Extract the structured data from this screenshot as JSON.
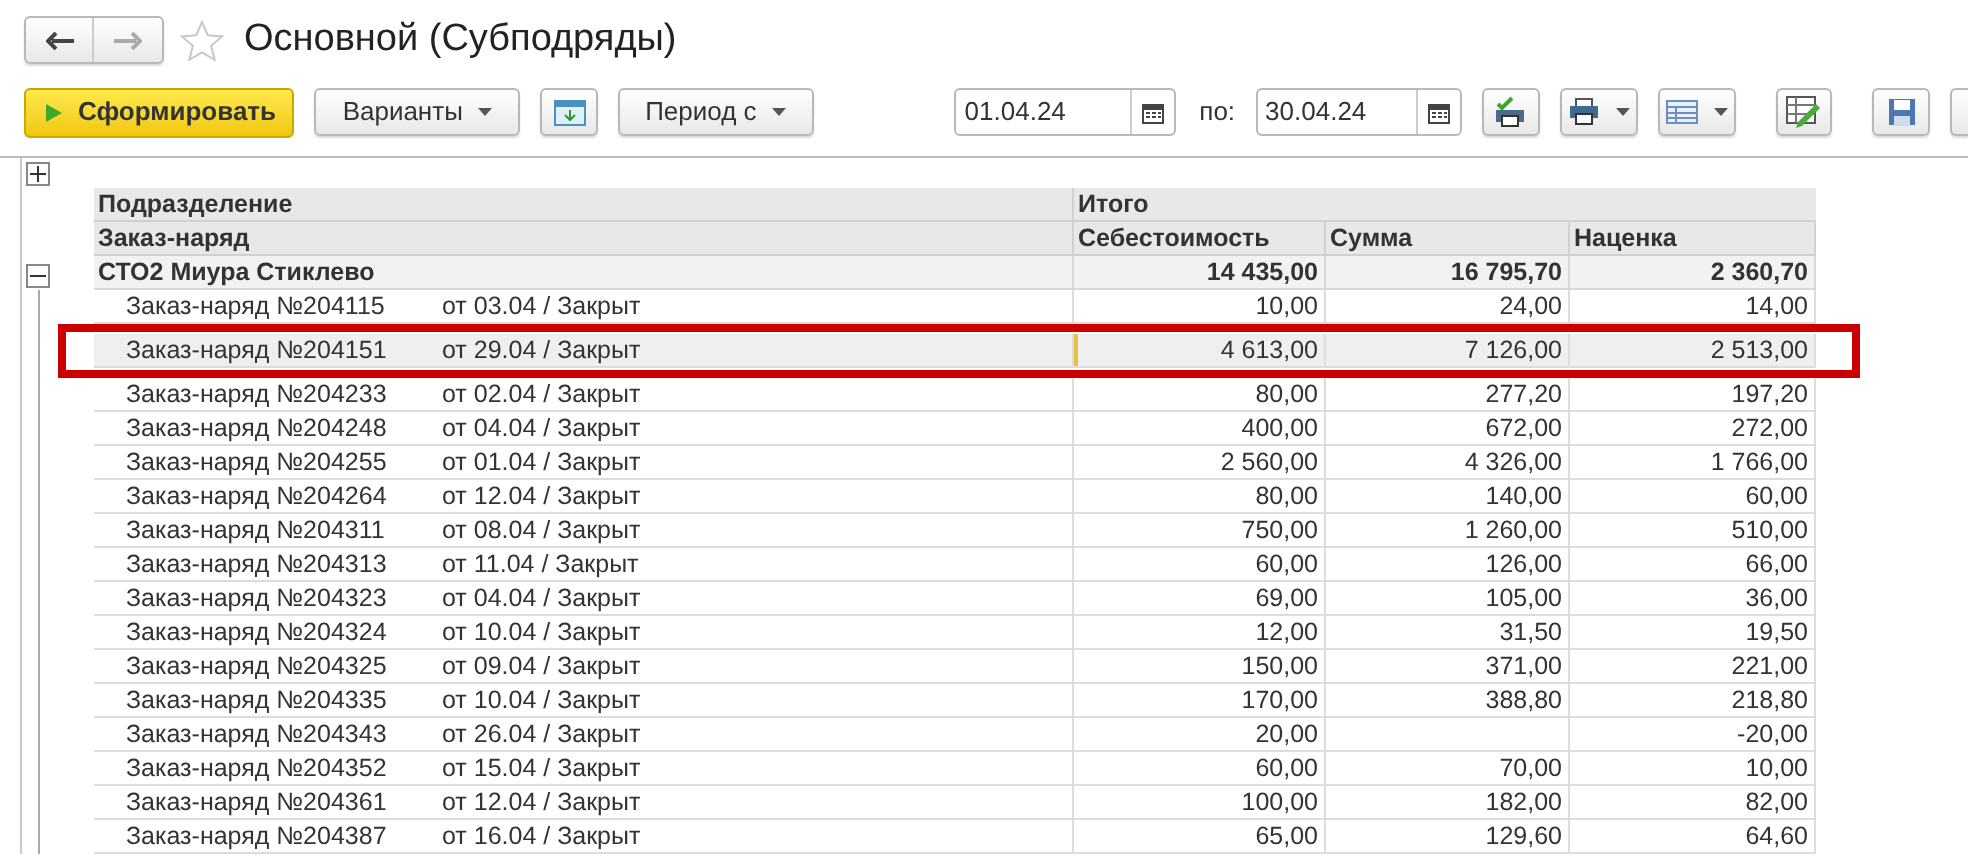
{
  "window": {
    "title": "Основной (Субподряды)",
    "favorite": false
  },
  "toolbar": {
    "generate_button": "Сформировать",
    "variants_button": "Варианты",
    "period_button": "Период с",
    "date_from": "01.04.24",
    "to_label": "по:",
    "date_to": "30.04.24"
  },
  "table": {
    "header_rows": [
      {
        "column_1": "Подразделение",
        "column_2": "Итого"
      },
      {
        "column_1": "Заказ-наряд",
        "columns": [
          "Себестоимость",
          "Сумма",
          "Наценка"
        ]
      }
    ],
    "group": {
      "name": "СТО2 Миура Стиклево",
      "expanded": true,
      "values": [
        "14 435,00",
        "16 795,70",
        "2 360,70"
      ]
    },
    "rows": [
      {
        "order": "Заказ-наряд №204115",
        "date_status": "от 03.04 / Закрыт",
        "cost": "10,00",
        "sum": "24,00",
        "markup": "14,00",
        "selected": false,
        "highlighted": false
      },
      {
        "order": "Заказ-наряд №204151",
        "date_status": "от 29.04 / Закрыт",
        "cost": "4 613,00",
        "sum": "7 126,00",
        "markup": "2 513,00",
        "selected": true,
        "highlighted": true
      },
      {
        "order": "Заказ-наряд №204233",
        "date_status": "от 02.04 / Закрыт",
        "cost": "80,00",
        "sum": "277,20",
        "markup": "197,20",
        "selected": false,
        "highlighted": false
      },
      {
        "order": "Заказ-наряд №204248",
        "date_status": "от 04.04 / Закрыт",
        "cost": "400,00",
        "sum": "672,00",
        "markup": "272,00",
        "selected": false,
        "highlighted": false
      },
      {
        "order": "Заказ-наряд №204255",
        "date_status": "от 01.04 / Закрыт",
        "cost": "2 560,00",
        "sum": "4 326,00",
        "markup": "1 766,00",
        "selected": false,
        "highlighted": false
      },
      {
        "order": "Заказ-наряд №204264",
        "date_status": "от 12.04 / Закрыт",
        "cost": "80,00",
        "sum": "140,00",
        "markup": "60,00",
        "selected": false,
        "highlighted": false
      },
      {
        "order": "Заказ-наряд №204311",
        "date_status": "от 08.04 / Закрыт",
        "cost": "750,00",
        "sum": "1 260,00",
        "markup": "510,00",
        "selected": false,
        "highlighted": false
      },
      {
        "order": "Заказ-наряд №204313",
        "date_status": "от 11.04 / Закрыт",
        "cost": "60,00",
        "sum": "126,00",
        "markup": "66,00",
        "selected": false,
        "highlighted": false
      },
      {
        "order": "Заказ-наряд №204323",
        "date_status": "от 04.04 / Закрыт",
        "cost": "69,00",
        "sum": "105,00",
        "markup": "36,00",
        "selected": false,
        "highlighted": false
      },
      {
        "order": "Заказ-наряд №204324",
        "date_status": "от 10.04 / Закрыт",
        "cost": "12,00",
        "sum": "31,50",
        "markup": "19,50",
        "selected": false,
        "highlighted": false
      },
      {
        "order": "Заказ-наряд №204325",
        "date_status": "от 09.04 / Закрыт",
        "cost": "150,00",
        "sum": "371,00",
        "markup": "221,00",
        "selected": false,
        "highlighted": false
      },
      {
        "order": "Заказ-наряд №204335",
        "date_status": "от 10.04 / Закрыт",
        "cost": "170,00",
        "sum": "388,80",
        "markup": "218,80",
        "selected": false,
        "highlighted": false
      },
      {
        "order": "Заказ-наряд №204343",
        "date_status": "от 26.04 / Закрыт",
        "cost": "20,00",
        "markup": "-20,00",
        "selected": false,
        "highlighted": false
      },
      {
        "order": "Заказ-наряд №204352",
        "date_status": "от 15.04 / Закрыт",
        "cost": "60,00",
        "sum": "70,00",
        "markup": "10,00",
        "selected": false,
        "highlighted": false
      },
      {
        "order": "Заказ-наряд №204361",
        "date_status": "от 12.04 / Закрыт",
        "cost": "100,00",
        "sum": "182,00",
        "markup": "82,00",
        "selected": false,
        "highlighted": false
      },
      {
        "order": "Заказ-наряд №204387",
        "date_status": "от 16.04 / Закрыт",
        "cost": "65,00",
        "sum": "129,60",
        "markup": "64,60",
        "selected": false,
        "highlighted": false
      }
    ]
  }
}
